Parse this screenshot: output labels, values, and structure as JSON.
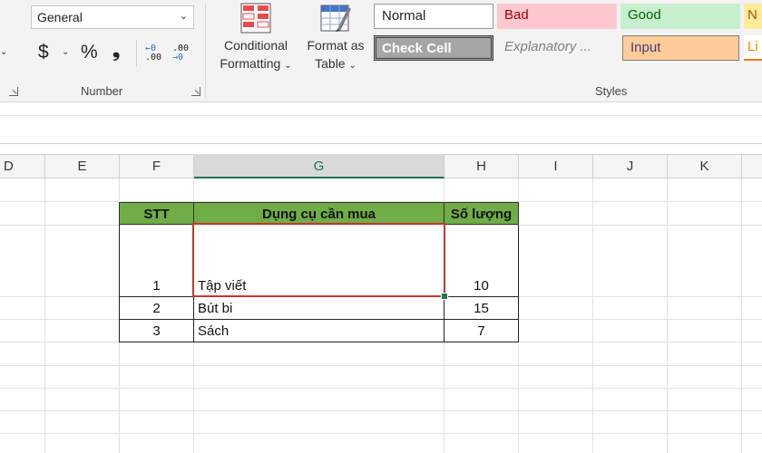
{
  "ribbon": {
    "number_group": {
      "format_value": "General",
      "currency_symbol": "$",
      "percent_symbol": "%",
      "comma_symbol": "❟",
      "increase_decimal_top": "←0",
      "increase_decimal_bottom": ".00",
      "decrease_decimal_top": ".00",
      "decrease_decimal_bottom": "→0",
      "label": "Number"
    },
    "conditional_formatting": {
      "line1": "Conditional",
      "line2": "Formatting"
    },
    "format_as_table": {
      "line1": "Format as",
      "line2": "Table"
    },
    "styles_group": {
      "label": "Styles",
      "cells": [
        {
          "label": "Normal",
          "bg": "#ffffff",
          "fg": "#222222"
        },
        {
          "label": "Bad",
          "bg": "#ffc7ce",
          "fg": "#9c0006"
        },
        {
          "label": "Good",
          "bg": "#c6efce",
          "fg": "#006100"
        },
        {
          "label": "N",
          "bg": "#ffeb9c",
          "fg": "#9c5700"
        },
        {
          "label": "Check Cell",
          "bg": "#a5a5a5",
          "fg": "#ffffff"
        },
        {
          "label": "Explanatory ...",
          "bg": "#f3f3f3",
          "fg": "#7f7f7f"
        },
        {
          "label": "Input",
          "bg": "#ffcc99",
          "fg": "#3f3f76"
        },
        {
          "label": "Li",
          "bg": "#ffffff",
          "fg": "#fa7d00"
        }
      ]
    }
  },
  "sheet": {
    "columns": [
      "D",
      "E",
      "F",
      "G",
      "H",
      "I",
      "J",
      "K"
    ],
    "selected_column": "G",
    "header_fill": "#70ad47",
    "table": {
      "headers": [
        "STT",
        "Dụng cụ cần mua",
        "Số lượng"
      ],
      "rows": [
        [
          "1",
          "Tập viết",
          "10"
        ],
        [
          "2",
          "Bút bi",
          "15"
        ],
        [
          "3",
          "Sách",
          "7"
        ]
      ]
    }
  }
}
